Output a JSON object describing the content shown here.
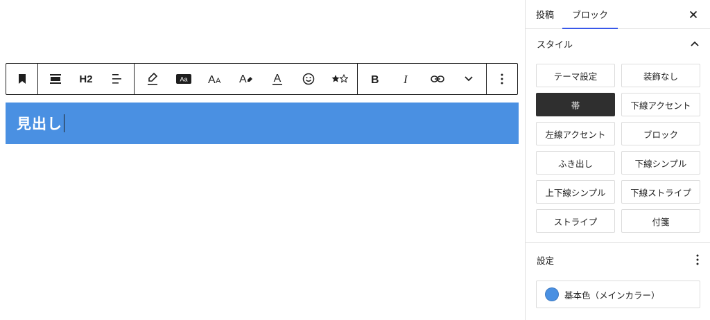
{
  "toolbar": {
    "heading_level": "H2"
  },
  "block": {
    "heading_text": "見出し",
    "background_color": "#4a90e2"
  },
  "sidebar": {
    "tabs": [
      {
        "label": "投稿",
        "active": false
      },
      {
        "label": "ブロック",
        "active": true
      }
    ],
    "styles_panel": {
      "title": "スタイル",
      "options": [
        {
          "label": "テーマ設定",
          "selected": false
        },
        {
          "label": "装飾なし",
          "selected": false
        },
        {
          "label": "帯",
          "selected": true
        },
        {
          "label": "下線アクセント",
          "selected": false
        },
        {
          "label": "左線アクセント",
          "selected": false
        },
        {
          "label": "ブロック",
          "selected": false
        },
        {
          "label": "ふき出し",
          "selected": false
        },
        {
          "label": "下線シンプル",
          "selected": false
        },
        {
          "label": "上下線シンプル",
          "selected": false
        },
        {
          "label": "下線ストライプ",
          "selected": false
        },
        {
          "label": "ストライプ",
          "selected": false
        },
        {
          "label": "付箋",
          "selected": false
        }
      ]
    },
    "settings_panel": {
      "title": "設定",
      "color_label": "基本色（メインカラー）",
      "color_value": "#4a90e2"
    }
  },
  "colors": {
    "accent": "#3858e9",
    "selected_bg": "#2f2f2f"
  }
}
